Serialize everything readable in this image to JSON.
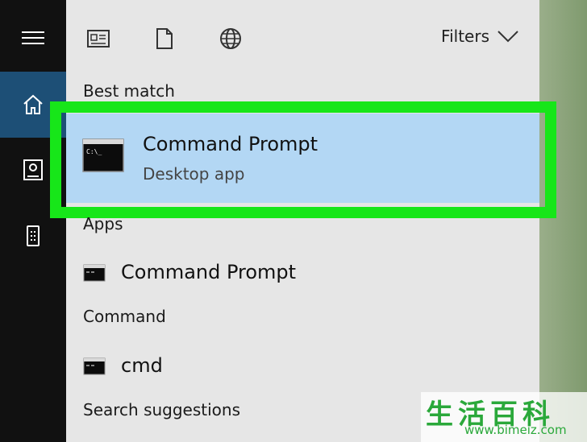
{
  "rail": {
    "items": [
      {
        "name": "menu-icon"
      },
      {
        "name": "home-icon",
        "selected": true
      },
      {
        "name": "documents-icon"
      },
      {
        "name": "device-icon"
      }
    ],
    "accent": "#1d4f76"
  },
  "toolbar": {
    "icons": [
      "apps-icon",
      "document-icon",
      "web-icon"
    ],
    "filters_label": "Filters"
  },
  "best_match": {
    "heading": "Best match",
    "title": "Command Prompt",
    "subtitle": "Desktop app",
    "highlight_color": "#17e619",
    "selection_color": "#b3d7f4"
  },
  "apps": {
    "heading": "Apps",
    "items": [
      {
        "label": "Command Prompt"
      }
    ]
  },
  "command": {
    "heading": "Command",
    "items": [
      {
        "label": "cmd"
      }
    ]
  },
  "search_suggestions": {
    "heading": "Search suggestions"
  },
  "watermark": {
    "chars": "生活百科",
    "url": "www.bimeiz.com"
  }
}
